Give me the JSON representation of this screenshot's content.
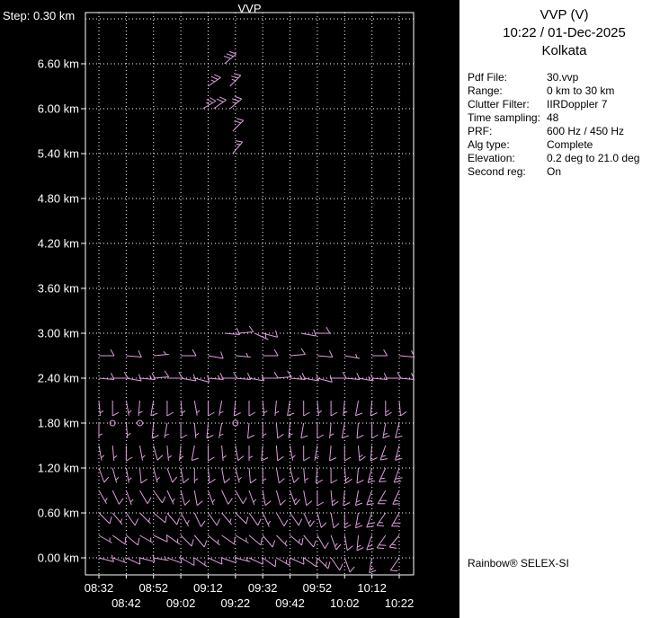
{
  "plot": {
    "title": "VVP",
    "step_label": "Step: 0.30 km",
    "bg_color": "#000000",
    "grid_color": "#ffffff",
    "barb_color": "#DDA0DD",
    "y_axis": {
      "labels": [
        {
          "h": 6.6,
          "text": "6.60 km"
        },
        {
          "h": 6.0,
          "text": "6.00 km"
        },
        {
          "h": 5.4,
          "text": "5.40 km"
        },
        {
          "h": 4.8,
          "text": "4.80 km"
        },
        {
          "h": 4.2,
          "text": "4.20 km"
        },
        {
          "h": 3.6,
          "text": "3.60 km"
        },
        {
          "h": 3.0,
          "text": "3.00 km"
        },
        {
          "h": 2.4,
          "text": "2.40 km"
        },
        {
          "h": 1.8,
          "text": "1.80 km"
        },
        {
          "h": 1.2,
          "text": "1.20 km"
        },
        {
          "h": 0.6,
          "text": "0.60 km"
        },
        {
          "h": 0.0,
          "text": "0.00 km"
        }
      ]
    },
    "x_axis": {
      "labels": [
        {
          "t": 0,
          "text": "08:32",
          "row": 1
        },
        {
          "t": 10,
          "text": "08:42",
          "row": 2
        },
        {
          "t": 20,
          "text": "08:52",
          "row": 1
        },
        {
          "t": 30,
          "text": "09:02",
          "row": 2
        },
        {
          "t": 40,
          "text": "09:12",
          "row": 1
        },
        {
          "t": 50,
          "text": "09:22",
          "row": 2
        },
        {
          "t": 60,
          "text": "09:32",
          "row": 1
        },
        {
          "t": 70,
          "text": "09:42",
          "row": 2
        },
        {
          "t": 80,
          "text": "09:52",
          "row": 1
        },
        {
          "t": 90,
          "text": "10:02",
          "row": 2
        },
        {
          "t": 100,
          "text": "10:12",
          "row": 1
        },
        {
          "t": 110,
          "text": "10:22",
          "row": 2
        }
      ]
    }
  },
  "chart_data": {
    "type": "wind-barb-profile",
    "title": "VVP",
    "x_ticks": [
      "08:32",
      "08:42",
      "08:52",
      "09:02",
      "09:12",
      "09:22",
      "09:32",
      "09:42",
      "09:52",
      "10:02",
      "10:12",
      "10:22"
    ],
    "y_unit": "km",
    "y_step_km": 0.3,
    "y_range": [
      0,
      7.2
    ],
    "calm_note": "spd 0 = calm circle, null = no data",
    "wind_rows": [
      {
        "h": 2.7,
        "t0": 0,
        "dt": 10,
        "dirs": [
          90,
          95,
          85,
          90,
          100,
          95,
          90,
          85,
          95,
          100,
          90,
          95
        ],
        "spds": [
          10,
          10,
          5,
          10,
          10,
          5,
          10,
          10,
          10,
          5,
          10,
          10
        ]
      },
      {
        "h": 2.4,
        "t0": 0,
        "dt": 5,
        "dirs": [
          95,
          90,
          100,
          95,
          85,
          90,
          100,
          105,
          95,
          90,
          95,
          100,
          90,
          85,
          95,
          100,
          105,
          90,
          95,
          100,
          95,
          90,
          95
        ],
        "spds": [
          10,
          10,
          10,
          15,
          10,
          10,
          10,
          10,
          15,
          10,
          10,
          10,
          10,
          10,
          15,
          10,
          10,
          10,
          10,
          15,
          10,
          10,
          10
        ]
      },
      {
        "h": 2.1,
        "t0": 0,
        "dt": 5,
        "dirs": [
          175,
          180,
          170,
          185,
          190,
          180,
          175,
          170,
          180,
          190,
          185,
          180,
          175,
          185,
          190,
          180,
          175,
          180,
          185,
          190,
          185,
          180,
          175
        ],
        "spds": [
          5,
          10,
          5,
          5,
          10,
          10,
          5,
          5,
          10,
          5,
          10,
          10,
          5,
          5,
          10,
          10,
          5,
          10,
          5,
          10,
          10,
          15,
          10
        ]
      },
      {
        "h": 1.8,
        "t0": 0,
        "dt": 5,
        "dirs": [
          180,
          0,
          175,
          0,
          185,
          190,
          180,
          175,
          185,
          190,
          0,
          185,
          180,
          175,
          185,
          190,
          180,
          185,
          190,
          185,
          180,
          190,
          195
        ],
        "spds": [
          5,
          0,
          5,
          0,
          10,
          5,
          10,
          5,
          10,
          5,
          0,
          10,
          5,
          10,
          5,
          10,
          10,
          5,
          10,
          10,
          10,
          15,
          10
        ]
      },
      {
        "h": 1.5,
        "t0": 0,
        "dt": 5,
        "dirs": [
          170,
          175,
          180,
          170,
          165,
          175,
          185,
          190,
          180,
          175,
          170,
          180,
          185,
          175,
          170,
          180,
          190,
          185,
          180,
          175,
          185,
          200,
          195
        ],
        "spds": [
          5,
          5,
          10,
          5,
          10,
          5,
          5,
          10,
          10,
          5,
          10,
          5,
          10,
          10,
          5,
          10,
          5,
          10,
          10,
          15,
          10,
          15,
          15
        ]
      },
      {
        "h": 1.2,
        "t0": 0,
        "dt": 5,
        "dirs": [
          160,
          165,
          170,
          175,
          165,
          160,
          170,
          180,
          175,
          170,
          165,
          175,
          180,
          170,
          165,
          175,
          185,
          180,
          175,
          185,
          195,
          205,
          200
        ],
        "spds": [
          10,
          5,
          5,
          10,
          5,
          10,
          10,
          5,
          10,
          10,
          5,
          10,
          5,
          10,
          10,
          5,
          10,
          10,
          15,
          10,
          15,
          15,
          20
        ]
      },
      {
        "h": 0.9,
        "t0": 0,
        "dt": 5,
        "dirs": [
          150,
          155,
          160,
          150,
          145,
          155,
          165,
          170,
          160,
          155,
          150,
          160,
          170,
          165,
          160,
          170,
          180,
          175,
          185,
          190,
          200,
          210,
          205
        ],
        "spds": [
          5,
          10,
          5,
          10,
          10,
          5,
          10,
          10,
          5,
          10,
          10,
          5,
          10,
          10,
          15,
          10,
          10,
          15,
          10,
          15,
          15,
          20,
          15
        ]
      },
      {
        "h": 0.6,
        "t0": 0,
        "dt": 5,
        "dirs": [
          135,
          140,
          145,
          135,
          130,
          140,
          150,
          155,
          145,
          140,
          135,
          145,
          155,
          150,
          145,
          155,
          165,
          170,
          180,
          190,
          200,
          215,
          210
        ],
        "spds": [
          10,
          5,
          10,
          5,
          10,
          10,
          5,
          10,
          10,
          5,
          10,
          10,
          5,
          10,
          10,
          15,
          10,
          10,
          15,
          15,
          20,
          15,
          20
        ]
      },
      {
        "h": 0.3,
        "t0": 0,
        "dt": 5,
        "dirs": [
          120,
          125,
          130,
          120,
          115,
          125,
          135,
          140,
          130,
          125,
          120,
          130,
          140,
          135,
          130,
          140,
          150,
          160,
          170,
          185,
          200,
          215,
          220
        ],
        "spds": [
          5,
          10,
          10,
          5,
          10,
          5,
          10,
          10,
          5,
          10,
          5,
          10,
          10,
          5,
          15,
          10,
          10,
          15,
          10,
          15,
          15,
          20,
          15
        ]
      },
      {
        "h": 0.0,
        "t0": 0,
        "dt": 5,
        "dirs": [
          105,
          110,
          115,
          105,
          100,
          110,
          120,
          125,
          115,
          110,
          105,
          115,
          125,
          120,
          115,
          125,
          135,
          145,
          160,
          null,
          190,
          null,
          215
        ],
        "spds": [
          10,
          5,
          10,
          10,
          5,
          10,
          10,
          5,
          10,
          10,
          5,
          10,
          10,
          15,
          10,
          10,
          15,
          10,
          10,
          null,
          15,
          null,
          10
        ]
      }
    ],
    "extra_barbs": [
      [
        46,
        6.6,
        50,
        30
      ],
      [
        40,
        6.3,
        55,
        25
      ],
      [
        48,
        6.3,
        45,
        25
      ],
      [
        38,
        6.0,
        60,
        25
      ],
      [
        42,
        6.0,
        55,
        20
      ],
      [
        48,
        6.0,
        50,
        25
      ],
      [
        49,
        5.7,
        45,
        20
      ],
      [
        49,
        5.4,
        40,
        15
      ],
      [
        46,
        3.0,
        95,
        10
      ],
      [
        51,
        3.0,
        85,
        10
      ],
      [
        57,
        3.0,
        115,
        5
      ],
      [
        60,
        3.0,
        105,
        10
      ],
      [
        74,
        3.0,
        100,
        10
      ],
      [
        79,
        3.0,
        90,
        10
      ]
    ]
  },
  "panel": {
    "title": "VVP (V)",
    "datetime": "10:22 / 01-Dec-2025",
    "site": "Kolkata",
    "fields": [
      {
        "label": "Pdf File:",
        "value": "30.vvp"
      },
      {
        "label": "Range:",
        "value": "0 km to 30 km"
      },
      {
        "label": "Clutter Filter:",
        "value": "IIRDoppler 7"
      },
      {
        "label": "Time sampling:",
        "value": "48"
      },
      {
        "label": "PRF:",
        "value": "600 Hz / 450 Hz"
      },
      {
        "label": "Alg type:",
        "value": "Complete"
      },
      {
        "label": "Elevation:",
        "value": "0.2 deg to 21.0 deg"
      },
      {
        "label": "Second reg:",
        "value": "On"
      }
    ],
    "brand": "Rainbow® SELEX-SI"
  }
}
